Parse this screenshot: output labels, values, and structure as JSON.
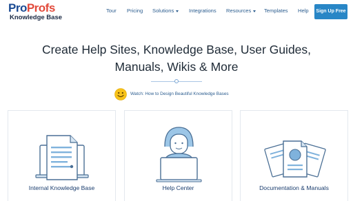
{
  "logo": {
    "part1": "Pro",
    "part2": "Profs",
    "subtitle": "Knowledge Base"
  },
  "nav": {
    "tour": "Tour",
    "pricing": "Pricing",
    "solutions": "Solutions",
    "integrations": "Integrations",
    "resources": "Resources",
    "templates": "Templates",
    "help": "Help",
    "signup": "Sign Up Free"
  },
  "hero": {
    "title_line1": "Create Help Sites, Knowledge Base, User Guides,",
    "title_line2": "Manuals, Wikis & More",
    "watch_text": "Watch: How to Design Beautiful Knowledge Bases"
  },
  "cards": [
    {
      "label": "Internal Knowledge Base",
      "icon": "document-monitor-icon"
    },
    {
      "label": "Help Center",
      "icon": "support-agent-icon"
    },
    {
      "label": "Documentation & Manuals",
      "icon": "documents-stack-icon"
    }
  ],
  "colors": {
    "brand_blue": "#1a4a93",
    "brand_red": "#e24a3b",
    "nav_text": "#2c5d8f",
    "signup_bg": "#2886c6",
    "icon_blue": "#7fb2dc",
    "smiley": "#f7c21a"
  }
}
